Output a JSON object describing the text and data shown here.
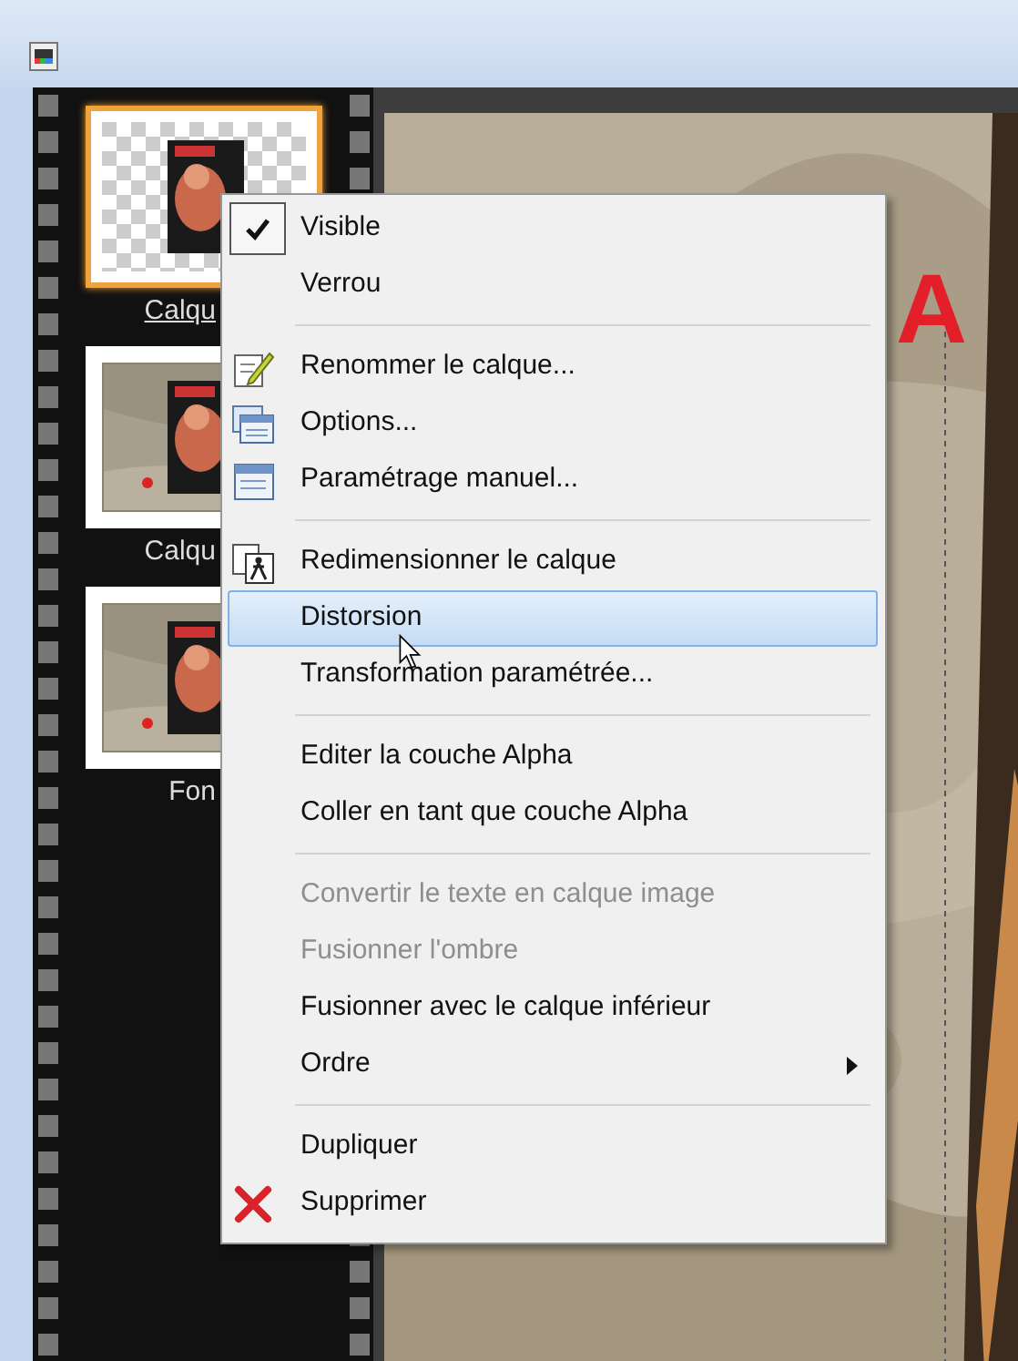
{
  "layers": [
    {
      "label": "Calqu",
      "selected": true,
      "transparent": true
    },
    {
      "label": "Calqu",
      "selected": false,
      "transparent": false
    },
    {
      "label": "Fon",
      "selected": false,
      "transparent": false
    }
  ],
  "canvas_text": "A",
  "context_menu": [
    {
      "kind": "check",
      "label": "Visible",
      "checked": true,
      "selected": false,
      "disabled": false
    },
    {
      "kind": "check",
      "label": "Verrou",
      "checked": false,
      "selected": false,
      "disabled": false
    },
    {
      "kind": "separator"
    },
    {
      "kind": "rename",
      "label": "Renommer le calque...",
      "selected": false,
      "disabled": false
    },
    {
      "kind": "options",
      "label": "Options...",
      "selected": false,
      "disabled": false
    },
    {
      "kind": "window",
      "label": "Paramétrage manuel...",
      "selected": false,
      "disabled": false
    },
    {
      "kind": "separator"
    },
    {
      "kind": "resize",
      "label": "Redimensionner le calque",
      "selected": false,
      "disabled": false
    },
    {
      "kind": "item",
      "label": "Distorsion",
      "selected": true,
      "disabled": false
    },
    {
      "kind": "item",
      "label": "Transformation paramétrée...",
      "selected": false,
      "disabled": false
    },
    {
      "kind": "separator"
    },
    {
      "kind": "item",
      "label": "Editer la couche Alpha",
      "selected": false,
      "disabled": false
    },
    {
      "kind": "item",
      "label": "Coller en tant que couche Alpha",
      "selected": false,
      "disabled": false
    },
    {
      "kind": "separator"
    },
    {
      "kind": "item",
      "label": "Convertir le texte en calque image",
      "selected": false,
      "disabled": true
    },
    {
      "kind": "item",
      "label": "Fusionner l'ombre",
      "selected": false,
      "disabled": true
    },
    {
      "kind": "item",
      "label": "Fusionner avec le calque inférieur",
      "selected": false,
      "disabled": false
    },
    {
      "kind": "submenu",
      "label": "Ordre",
      "selected": false,
      "disabled": false
    },
    {
      "kind": "separator"
    },
    {
      "kind": "item",
      "label": "Dupliquer",
      "selected": false,
      "disabled": false
    },
    {
      "kind": "delete",
      "label": "Supprimer",
      "selected": false,
      "disabled": false
    }
  ]
}
